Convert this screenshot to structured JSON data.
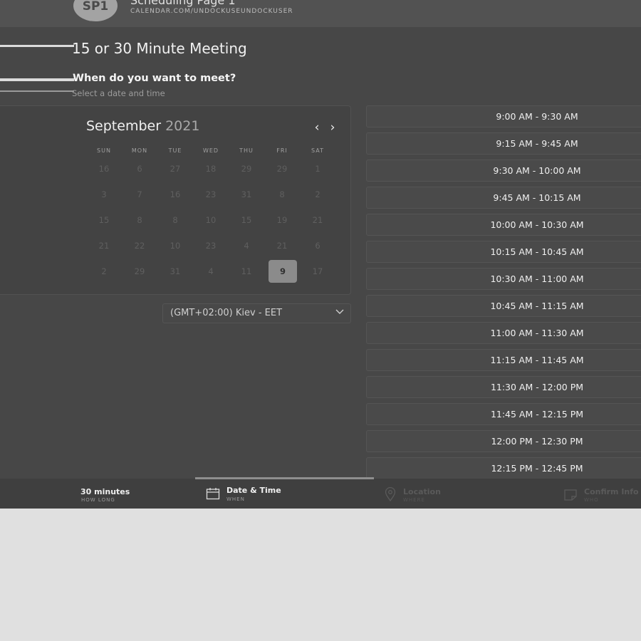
{
  "header": {
    "avatar": "SP1",
    "title": "Scheduling Page 1",
    "subtitle": "CALENDAR.COM/UNDOCKUSEUNDOCKUSER"
  },
  "meeting": {
    "title": "15 or 30 Minute Meeting",
    "question": "When do you want to meet?",
    "subtitle": "Select a date and time"
  },
  "calendar": {
    "month": "September",
    "year": "2021",
    "prev": "‹",
    "next": "›",
    "weekdays": [
      "SUN",
      "MON",
      "TUE",
      "WED",
      "THU",
      "FRI",
      "SAT"
    ],
    "weeks": [
      [
        "16",
        "6",
        "27",
        "18",
        "29",
        "29",
        "1"
      ],
      [
        "3",
        "7",
        "16",
        "23",
        "31",
        "8",
        "2"
      ],
      [
        "15",
        "8",
        "8",
        "10",
        "15",
        "19",
        "21"
      ],
      [
        "21",
        "22",
        "10",
        "23",
        "4",
        "21",
        "6"
      ],
      [
        "2",
        "29",
        "31",
        "4",
        "11",
        "9",
        "17"
      ]
    ],
    "selected": "9"
  },
  "timezone": {
    "value": "(GMT+02:00) Kiev - EET"
  },
  "slots": [
    "9:00 AM - 9:30 AM",
    "9:15 AM - 9:45 AM",
    "9:30 AM - 10:00 AM",
    "9:45 AM - 10:15 AM",
    "10:00 AM - 10:30 AM",
    "10:15 AM - 10:45 AM",
    "10:30 AM - 11:00 AM",
    "10:45 AM - 11:15 AM",
    "11:00 AM - 11:30 AM",
    "11:15 AM - 11:45 AM",
    "11:30 AM - 12:00 PM",
    "11:45 AM - 12:15 PM",
    "12:00 PM - 12:30 PM",
    "12:15 PM - 12:45 PM"
  ],
  "footer": {
    "steps": [
      {
        "label": "30 minutes",
        "sub": "HOW LONG",
        "icon": "clock-icon"
      },
      {
        "label": "Date & Time",
        "sub": "WHEN",
        "icon": "calendar-icon"
      },
      {
        "label": "Location",
        "sub": "WHERE",
        "icon": "location-pin-icon"
      },
      {
        "label": "Confirm Info",
        "sub": "WHO",
        "icon": "note-icon"
      }
    ]
  }
}
